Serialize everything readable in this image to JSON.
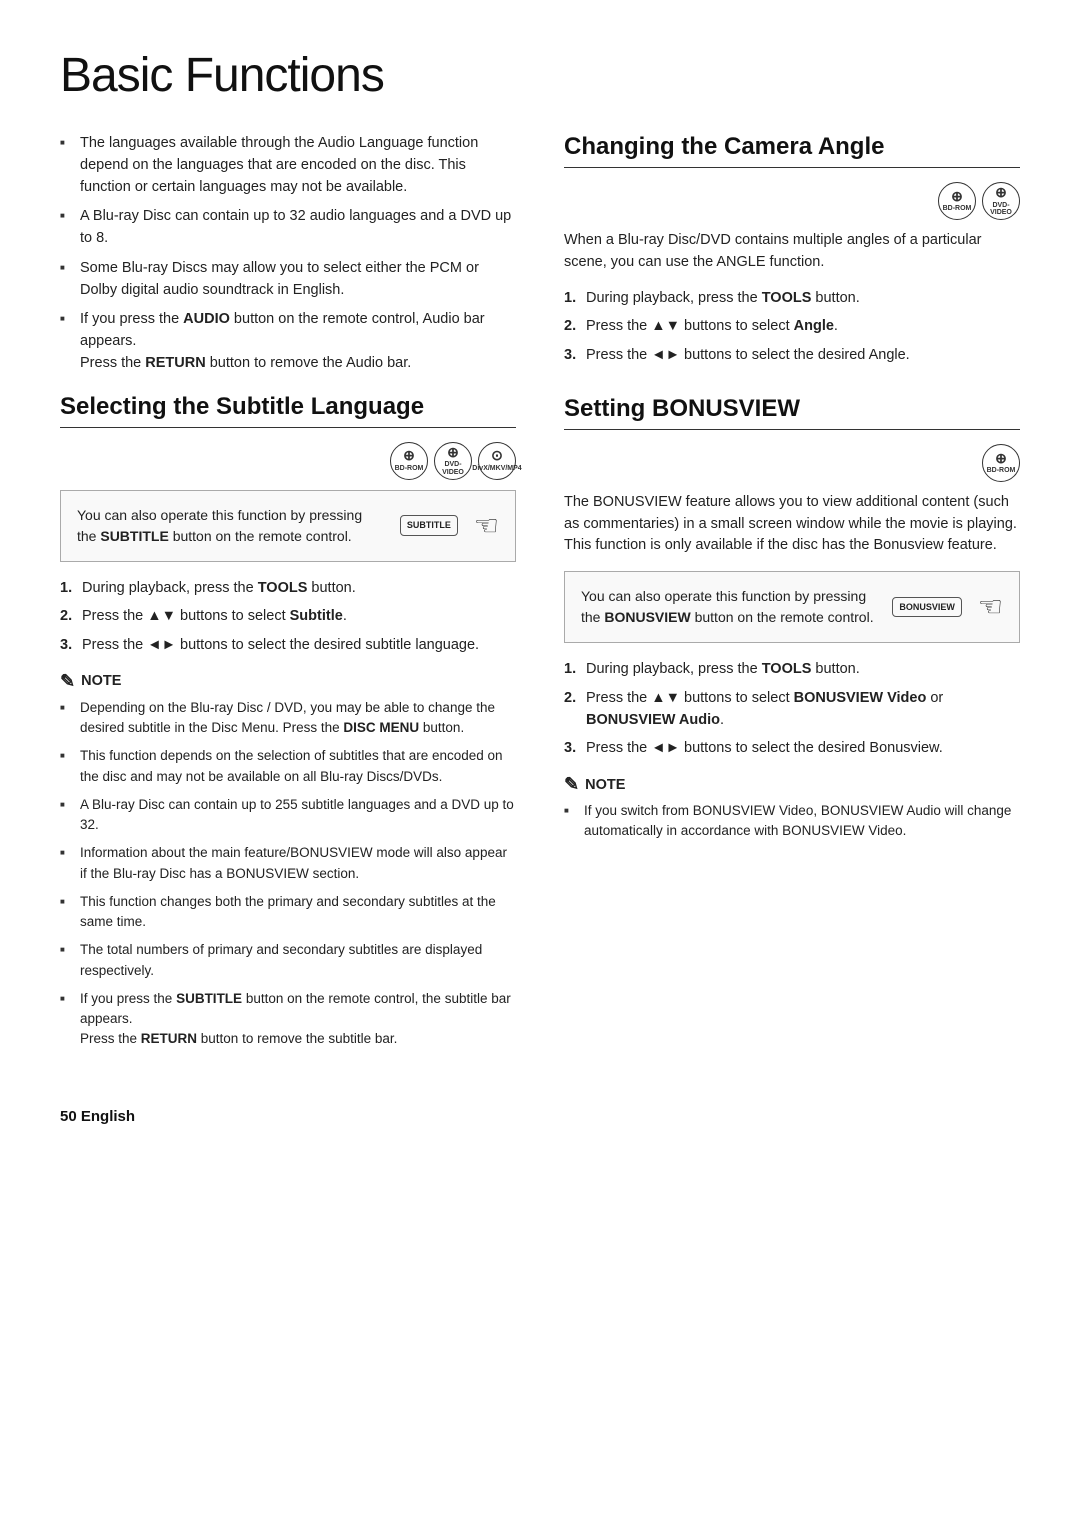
{
  "page": {
    "title": "Basic Functions",
    "footer": "50",
    "footer_lang": "English"
  },
  "left_col": {
    "intro_bullets": [
      "The languages available through the Audio Language function depend on the languages that are encoded on the disc. This function or certain languages may not be available.",
      "A Blu-ray Disc can contain up to 32 audio languages and a DVD up to 8.",
      "Some Blu-ray Discs may allow you to select either the PCM or Dolby digital audio soundtrack in English.",
      "If you press the AUDIO button on the remote control, Audio bar appears. Press the RETURN button to remove the Audio bar."
    ],
    "subtitle_section": {
      "title": "Selecting the Subtitle Language",
      "badges": [
        {
          "label": "BD-ROM",
          "icon": "⊕"
        },
        {
          "label": "DVD-VIDEO",
          "icon": "⊕"
        },
        {
          "label": "DivX/MKV/MP4",
          "icon": "⊙"
        }
      ],
      "callout": {
        "text_pre": "You can also operate this function by pressing the ",
        "button_label": "SUBTITLE",
        "text_mid": " button on the",
        "text_post": "remote control.",
        "button_display": "SUBTITLE"
      },
      "steps": [
        {
          "num": 1,
          "text_pre": "During playback, press the ",
          "bold": "TOOLS",
          "text_post": " button."
        },
        {
          "num": 2,
          "text_pre": "Press the ▲▼ buttons to select ",
          "bold": "Subtitle",
          "text_post": "."
        },
        {
          "num": 3,
          "text_pre": "Press the ◄► buttons to select the desired subtitle language.",
          "bold": "",
          "text_post": ""
        }
      ],
      "note_title": "NOTE",
      "note_bullets": [
        "Depending on the Blu-ray Disc / DVD, you may be able to change the desired subtitle in the Disc Menu. Press the DISC MENU button.",
        "This function depends on the selection of subtitles that are encoded on the disc and may not be available on all Blu-ray Discs/DVDs.",
        "A Blu-ray Disc can contain up to 255 subtitle languages and a DVD up to 32.",
        "Information about the main feature/BONUSVIEW mode will also appear if the Blu-ray Disc has a BONUSVIEW section.",
        "This function changes both the primary and secondary subtitles at the same time.",
        "The total numbers of primary and secondary subtitles are displayed respectively.",
        "If you press the SUBTITLE button on the remote control, the subtitle bar appears. Press the RETURN button to remove the subtitle bar."
      ]
    }
  },
  "right_col": {
    "camera_section": {
      "title": "Changing the Camera Angle",
      "badges": [
        {
          "label": "BD-ROM",
          "icon": "⊕"
        },
        {
          "label": "DVD-VIDEO",
          "icon": "⊕"
        }
      ],
      "intro": "When a Blu-ray Disc/DVD contains multiple angles of a particular scene, you can use the ANGLE function.",
      "steps": [
        {
          "num": 1,
          "text_pre": "During playback, press the ",
          "bold": "TOOLS",
          "text_post": " button."
        },
        {
          "num": 2,
          "text_pre": "Press the ▲▼ buttons to select ",
          "bold": "Angle",
          "text_post": "."
        },
        {
          "num": 3,
          "text_pre": "Press the ◄► buttons to select the desired Angle.",
          "bold": "",
          "text_post": ""
        }
      ]
    },
    "bonusview_section": {
      "title": "Setting BONUSVIEW",
      "badges": [
        {
          "label": "BD-ROM",
          "icon": "⊕"
        }
      ],
      "intro": "The BONUSVIEW feature allows you to view additional content (such as commentaries) in a small screen window while the movie is playing. This function is only available if the disc has the Bonusview feature.",
      "callout": {
        "text_pre": "You can also operate this function by pressing the ",
        "bold": "BONUSVIEW",
        "text_mid": " button on",
        "text_post": "the remote control.",
        "button_display": "BONUSVIEW"
      },
      "steps": [
        {
          "num": 1,
          "text_pre": "During playback, press the ",
          "bold": "TOOLS",
          "text_post": " button."
        },
        {
          "num": 2,
          "text_pre": "Press the ▲▼ buttons to select ",
          "bold": "BONUSVIEW Video",
          "text_post": " or ",
          "bold2": "BONUSVIEW Audio",
          "text_post2": "."
        },
        {
          "num": 3,
          "text_pre": "Press the ◄► buttons to select the desired Bonusview.",
          "bold": "",
          "text_post": ""
        }
      ],
      "note_title": "NOTE",
      "note_bullets": [
        "If you switch from BONUSVIEW Video, BONUSVIEW Audio will change automatically in accordance with BONUSVIEW Video."
      ]
    }
  }
}
